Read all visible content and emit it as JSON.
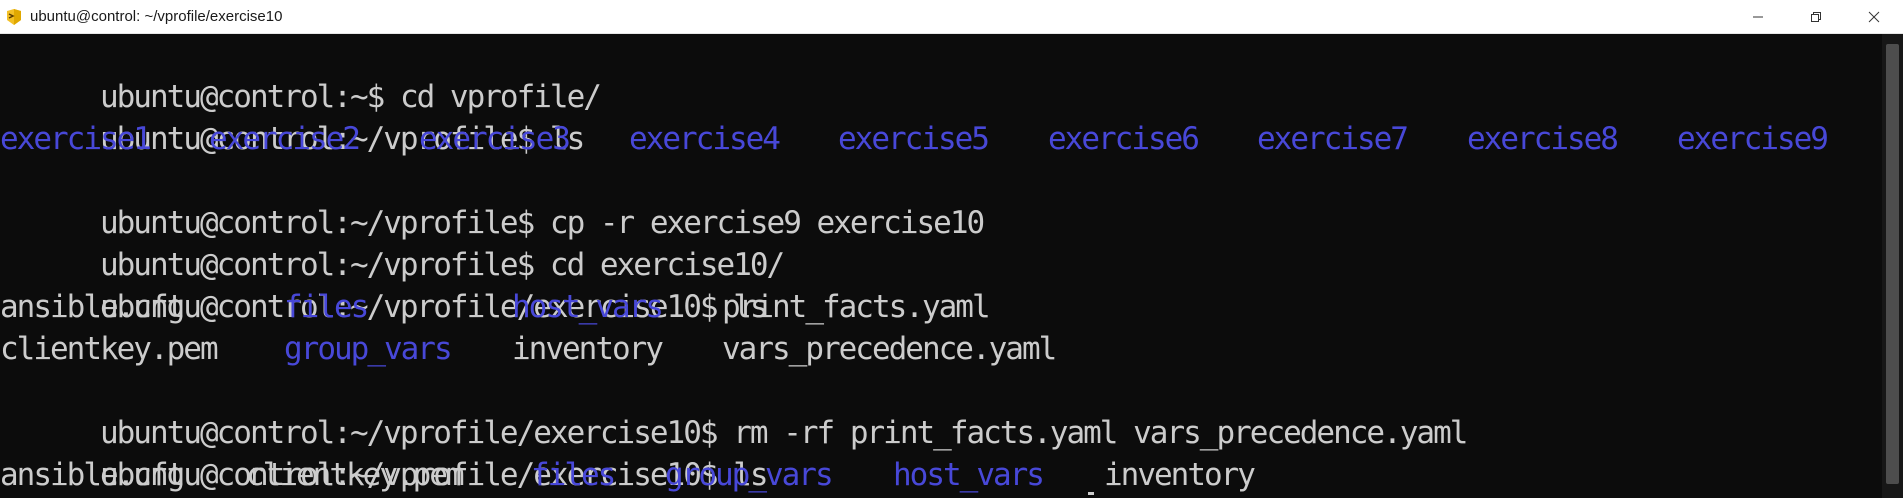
{
  "window": {
    "title": "ubuntu@control: ~/vprofile/exercise10",
    "controls": {
      "minimize_icon": "minimize-icon",
      "restore_icon": "restore-icon",
      "close_icon": "close-icon"
    }
  },
  "colors": {
    "background": "#0c0c0c",
    "text": "#cccccc",
    "directory": "#4848d8",
    "titlebar": "#ffffff"
  },
  "terminal": {
    "lines": [
      {
        "prompt": "ubuntu@control:~$ ",
        "command": "cd vprofile/"
      },
      {
        "prompt": "ubuntu@control:~/vprofile$ ",
        "command": "ls"
      },
      {
        "listing": [
          "exercise1",
          "exercise2",
          "exercise3",
          "exercise4",
          "exercise5",
          "exercise6",
          "exercise7",
          "exercise8",
          "exercise9"
        ]
      },
      {
        "prompt": "ubuntu@control:~/vprofile$ ",
        "command": "cp -r exercise9 exercise10"
      },
      {
        "prompt": "ubuntu@control:~/vprofile$ ",
        "command": "cd exercise10/"
      },
      {
        "prompt": "ubuntu@control:~/vprofile/exercise10$ ",
        "command": "ls"
      },
      {
        "files": [
          {
            "name": "ansible.cfg",
            "type": "file"
          },
          {
            "name": "files",
            "type": "dir"
          },
          {
            "name": "host_vars",
            "type": "dir"
          },
          {
            "name": "print_facts.yaml",
            "type": "file"
          }
        ]
      },
      {
        "files": [
          {
            "name": "clientkey.pem",
            "type": "file"
          },
          {
            "name": "group_vars",
            "type": "dir"
          },
          {
            "name": "inventory",
            "type": "file"
          },
          {
            "name": "vars_precedence.yaml",
            "type": "file"
          }
        ]
      },
      {
        "prompt": "ubuntu@control:~/vprofile/exercise10$ ",
        "command": "rm -rf print_facts.yaml vars_precedence.yaml"
      },
      {
        "prompt": "ubuntu@control:~/vprofile/exercise10$ ",
        "command": "ls"
      },
      {
        "files": [
          {
            "name": "ansible.cfg",
            "type": "file"
          },
          {
            "name": "clientkey.pem",
            "type": "file"
          },
          {
            "name": "files",
            "type": "dir"
          },
          {
            "name": "group_vars",
            "type": "dir"
          },
          {
            "name": "host_vars",
            "type": "dir"
          },
          {
            "name": "inventory",
            "type": "file"
          }
        ]
      }
    ]
  }
}
